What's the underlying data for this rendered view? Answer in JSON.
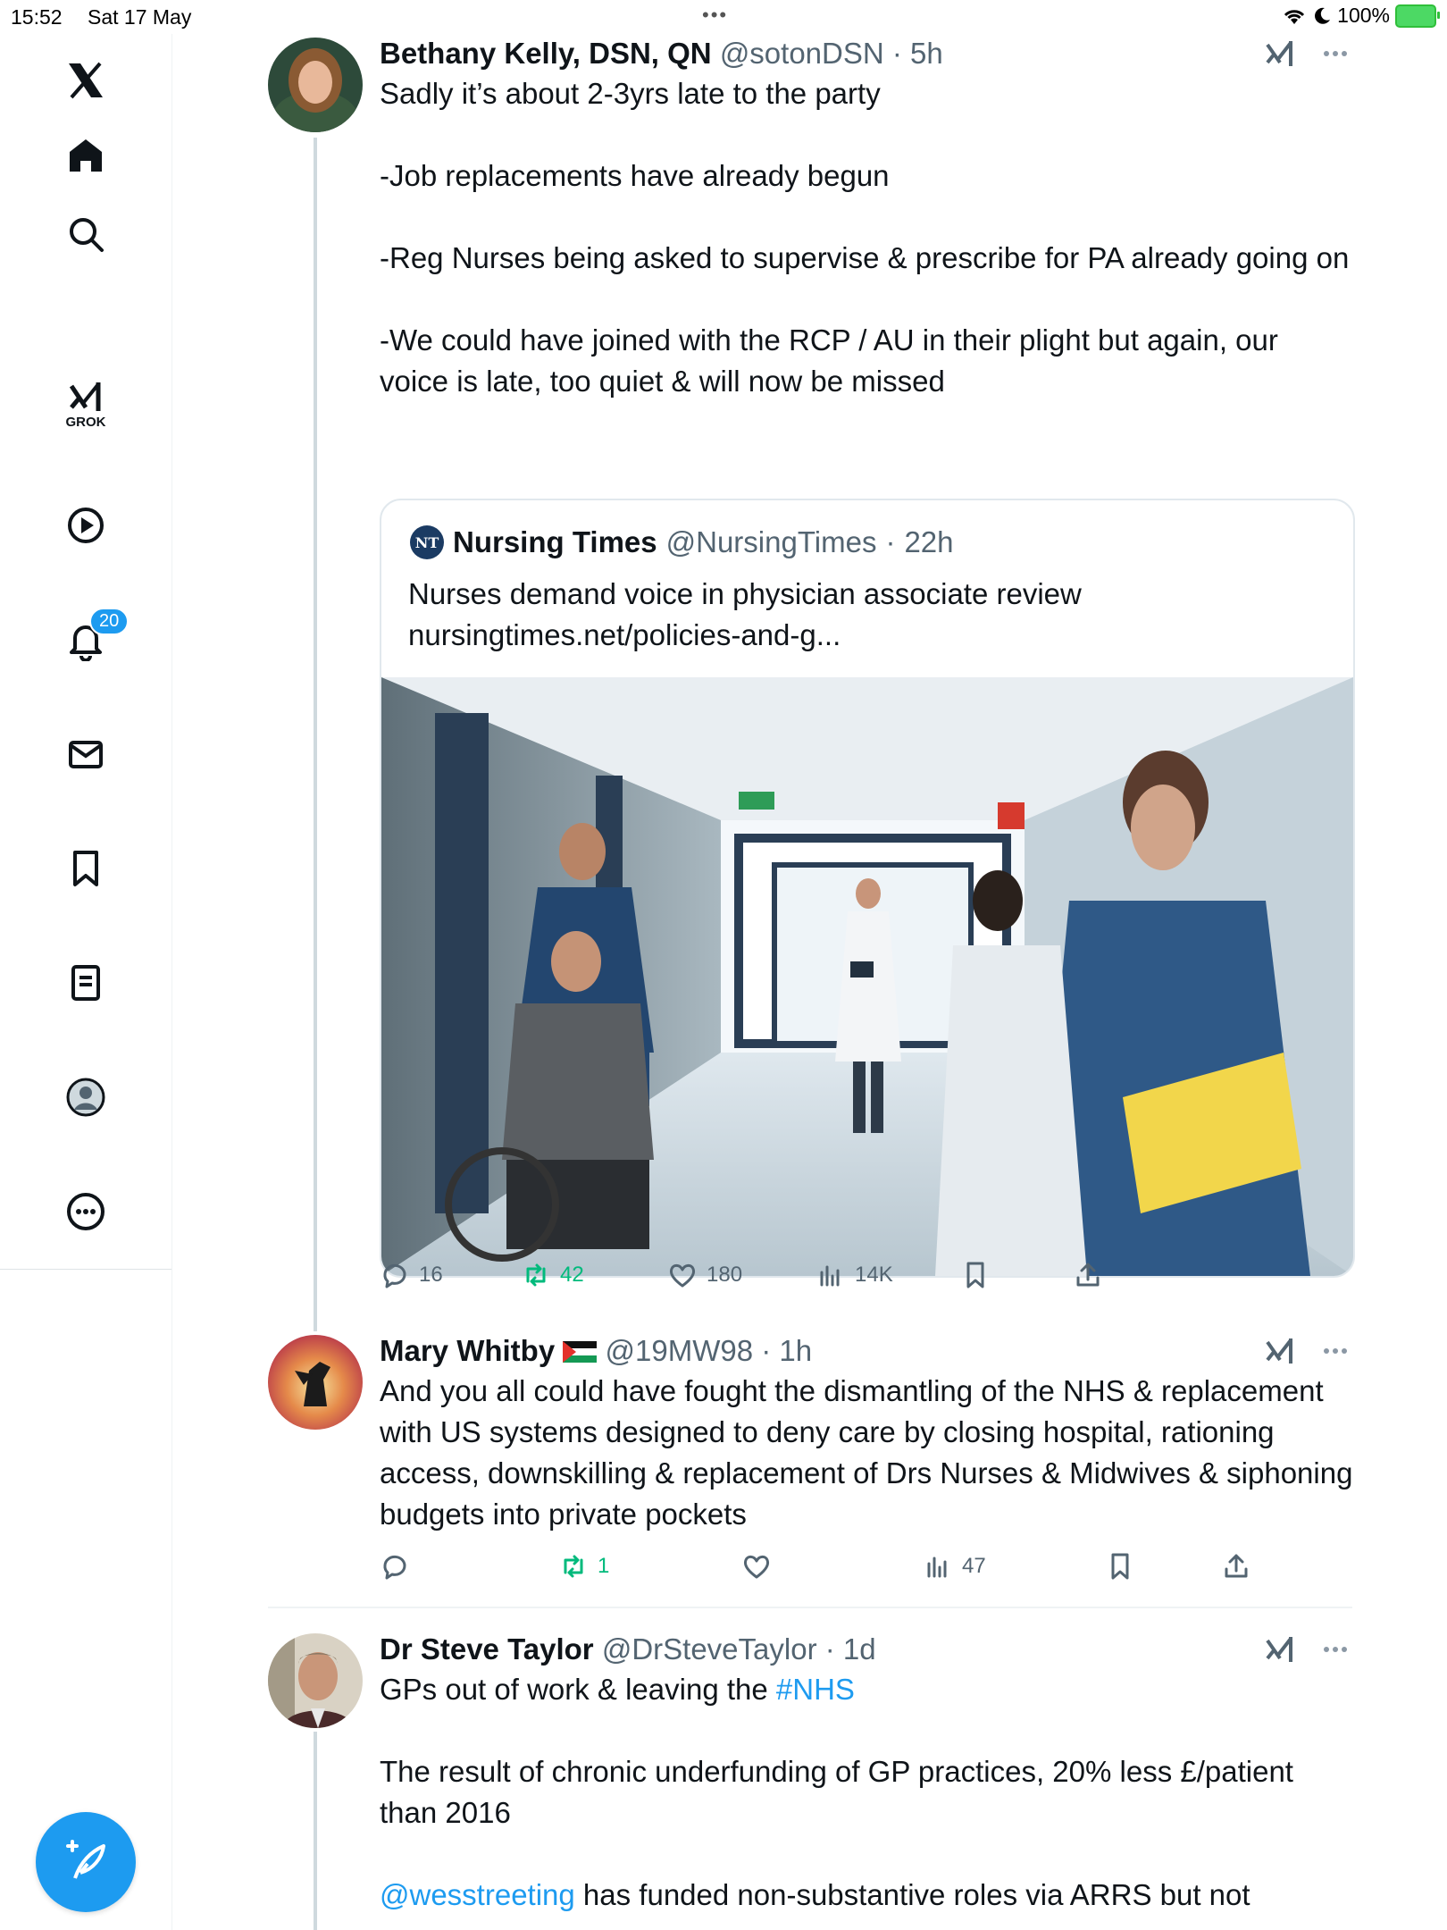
{
  "status_bar": {
    "time": "15:52",
    "date": "Sat 17 May",
    "battery": "100%"
  },
  "sidebar": {
    "grok_label": "GROK",
    "notification_count": "20"
  },
  "posts": [
    {
      "name": "Bethany Kelly, DSN, QN",
      "handle": "@sotonDSN",
      "time": "5h",
      "text": "Sadly it’s about 2-3yrs late to the party\n\n-Job replacements have already begun\n\n-Reg Nurses being asked to supervise & prescribe for PA already going on\n\n-We could have joined with the RCP / AU in their plight but again, our voice is late, too quiet & will now be missed",
      "quote": {
        "logo": "NT",
        "name": "Nursing Times",
        "handle": "@NursingTimes",
        "time": "22h",
        "text": "Nurses demand voice in physician associate review",
        "link": "nursingtimes.net/policies-and-g..."
      },
      "stats": {
        "replies": "16",
        "reposts": "42",
        "likes": "180",
        "views": "14K"
      }
    },
    {
      "name": "Mary Whitby",
      "handle": "@19MW98",
      "time": "1h",
      "text": "And you all could have fought the dismantling of the NHS & replacement with US systems designed to deny care by closing hospital, rationing access, downskilling & replacement of Drs Nurses & Midwives & siphoning budgets into private pockets",
      "stats": {
        "replies": "",
        "reposts": "1",
        "likes": "",
        "views": "47"
      }
    },
    {
      "name": "Dr Steve Taylor",
      "handle": "@DrSteveTaylor",
      "time": "1d",
      "text_line1": "GPs out of work & leaving the ",
      "hashtag": "#NHS",
      "text_para2": "The result of chronic underfunding of GP practices, 20% less £/patient than 2016",
      "mention": "@wesstreeting",
      "text_para3": " has funded non-substantive roles via ARRS but not"
    }
  ],
  "colors": {
    "accent": "#1d9bf0",
    "repost": "#00ba7c",
    "muted": "#536471"
  }
}
